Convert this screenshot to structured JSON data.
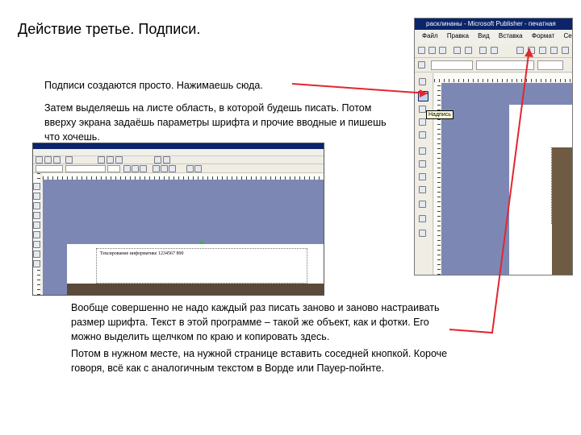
{
  "title": "Действие третье. Подписи.",
  "paragraphs": {
    "p1": "Подписи создаются просто. Нажимаешь сюда.",
    "p2": "Затем выделяешь на листе область, в которой будешь писать. Потом вверху экрана задаёшь параметры шрифта и прочие вводные и пишешь что хочешь.",
    "p3": "Вообще совершенно не надо каждый раз писать заново и заново настраивать размер шрифта. Текст в этой программе – такой же объект, как и фотки. Его можно выделить щелчком по краю и копировать здесь.",
    "p4": "Потом в нужном месте, на нужной странице вставить соседней кнопкой. Короче говоря, всё как с аналогичным текстом в Ворде или Пауер-пойнте."
  },
  "right_screenshot": {
    "window_title": "расклинаны - Microsoft Publisher - печатная",
    "menu": [
      "Файл",
      "Правка",
      "Вид",
      "Вставка",
      "Формат",
      "Серви"
    ],
    "tooltip": "Надпись",
    "accent_blue": "#7c88b3"
  },
  "left_screenshot": {
    "textbox_text": "Тексирование информатике   1234567 890"
  },
  "colors": {
    "arrow": "#e3262f",
    "workspace": "#7c88b3"
  }
}
